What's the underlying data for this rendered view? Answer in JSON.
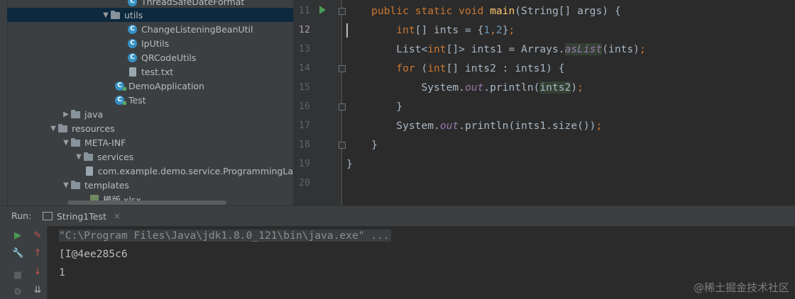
{
  "project_tree": {
    "items": [
      {
        "label": "ThreadSafeDateFormat",
        "type": "class"
      },
      {
        "label": "utils",
        "type": "folder",
        "expanded": true,
        "selected": true
      },
      {
        "label": "ChangeListeningBeanUtil",
        "type": "class"
      },
      {
        "label": "IpUtils",
        "type": "class"
      },
      {
        "label": "QRCodeUtils",
        "type": "class"
      },
      {
        "label": "test.txt",
        "type": "file"
      },
      {
        "label": "DemoApplication",
        "type": "class-run"
      },
      {
        "label": "Test",
        "type": "class-run"
      },
      {
        "label": "java",
        "type": "folder",
        "expanded": false
      },
      {
        "label": "resources",
        "type": "folder",
        "expanded": true
      },
      {
        "label": "META-INF",
        "type": "folder",
        "expanded": true
      },
      {
        "label": "services",
        "type": "folder",
        "expanded": true
      },
      {
        "label": "com.example.demo.service.ProgrammingLa",
        "type": "file"
      },
      {
        "label": "templates",
        "type": "folder",
        "expanded": true
      },
      {
        "label": "模版.xlsx",
        "type": "xlsx"
      }
    ]
  },
  "editor": {
    "line_numbers": [
      "11",
      "12",
      "13",
      "14",
      "15",
      "16",
      "17",
      "18",
      "19",
      "20"
    ],
    "current_line": "12",
    "lines": {
      "l11": {
        "indent": "    ",
        "kw1": "public static void ",
        "fn": "main",
        "rest": "(String[] args) {"
      },
      "l12": {
        "indent": "        ",
        "kw1": "int",
        "mid": "[] ints = {",
        "n1": "1",
        "comma": ",",
        "n2": "2",
        "end": "}",
        "semi": ";"
      },
      "l13": {
        "indent": "        ",
        "a": "List<",
        "kw1": "int",
        "b": "[]> ints1 = Arrays.",
        "it": "asList",
        "c": "(ints)",
        "semi": ";"
      },
      "l14": {
        "indent": "        ",
        "kw1": "for",
        "a": " (",
        "kw2": "int",
        "b": "[] ints2 : ints1) {"
      },
      "l15": {
        "indent": "            ",
        "a": "System.",
        "it": "out",
        "b": ".println(",
        "hl": "ints2",
        "c": ")",
        "semi": ";"
      },
      "l16": {
        "indent": "        ",
        "a": "}"
      },
      "l17": {
        "indent": "        ",
        "a": "System.",
        "it": "out",
        "b": ".println(ints1.size())",
        "semi": ";"
      },
      "l18": {
        "indent": "    ",
        "a": "}"
      },
      "l19": {
        "indent": "",
        "a": "}"
      }
    }
  },
  "run_panel": {
    "label": "Run:",
    "tab_label": "String1Test",
    "tab_close": "×",
    "console_lines": [
      "\"C:\\Program Files\\Java\\jdk1.8.0_121\\bin\\java.exe\" ...",
      "[I@4ee285c6",
      "1"
    ]
  },
  "watermark": "@稀土掘金技术社区",
  "colors": {
    "keyword": "#cc7832",
    "function": "#ffc66d",
    "number": "#6897bb",
    "field_italic": "#9876aa",
    "run_green": "#499c54"
  }
}
